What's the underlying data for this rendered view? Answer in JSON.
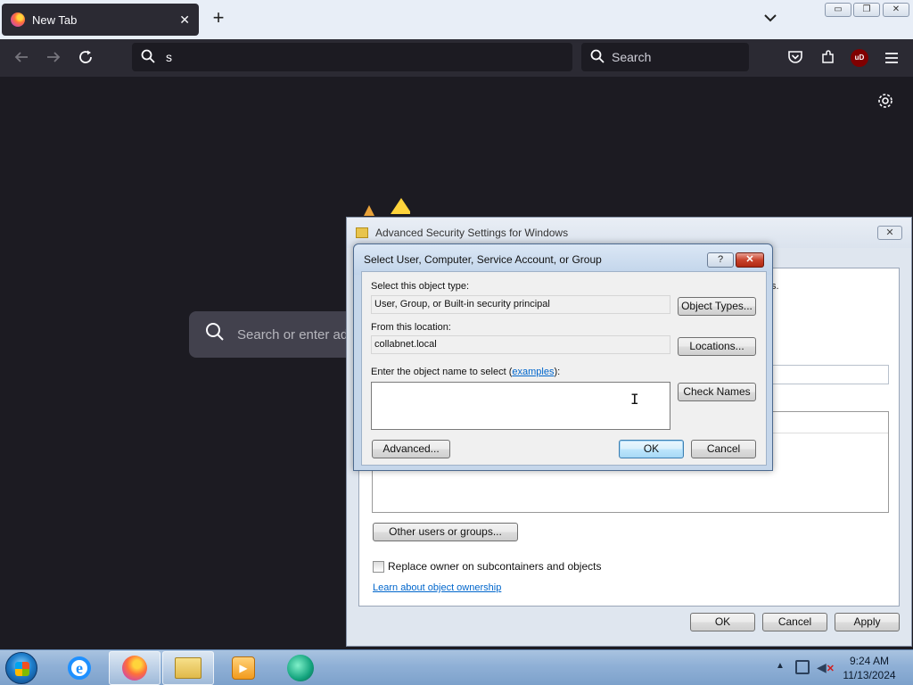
{
  "browser": {
    "tab_title": "New Tab",
    "tab_close": "✕",
    "new_tab": "+",
    "url_value": "s",
    "search_placeholder": "Search",
    "ublock_label": "uD",
    "ntp_search_placeholder": "Search or enter address"
  },
  "adv_window": {
    "title": "Advanced Security Settings for Windows",
    "close_label": "✕",
    "fragment_text": "s.",
    "other_users_button": "Other users or groups...",
    "replace_owner_label": "Replace owner on subcontainers and objects",
    "replace_owner_checked": false,
    "learn_link": "Learn about object ownership",
    "ok_label": "OK",
    "cancel_label": "Cancel",
    "apply_label": "Apply"
  },
  "select_dialog": {
    "title": "Select User, Computer, Service Account, or Group",
    "help_label": "?",
    "close_label": "✕",
    "object_type_label": "Select this object type:",
    "object_type_value": "User, Group, or Built-in security principal",
    "object_types_button": "Object Types...",
    "location_label": "From this location:",
    "location_value": "collabnet.local",
    "locations_button": "Locations...",
    "enter_name_prefix": "Enter the object name to select (",
    "enter_name_link": "examples",
    "enter_name_suffix": "):",
    "name_value": "",
    "check_names_button": "Check Names",
    "advanced_button": "Advanced...",
    "ok_label": "OK",
    "cancel_label": "Cancel"
  },
  "taskbar": {
    "clock_time": "9:24 AM",
    "clock_date": "11/13/2024",
    "apps": [
      "internet-explorer",
      "firefox",
      "windows-explorer",
      "media-player",
      "green-app"
    ]
  }
}
